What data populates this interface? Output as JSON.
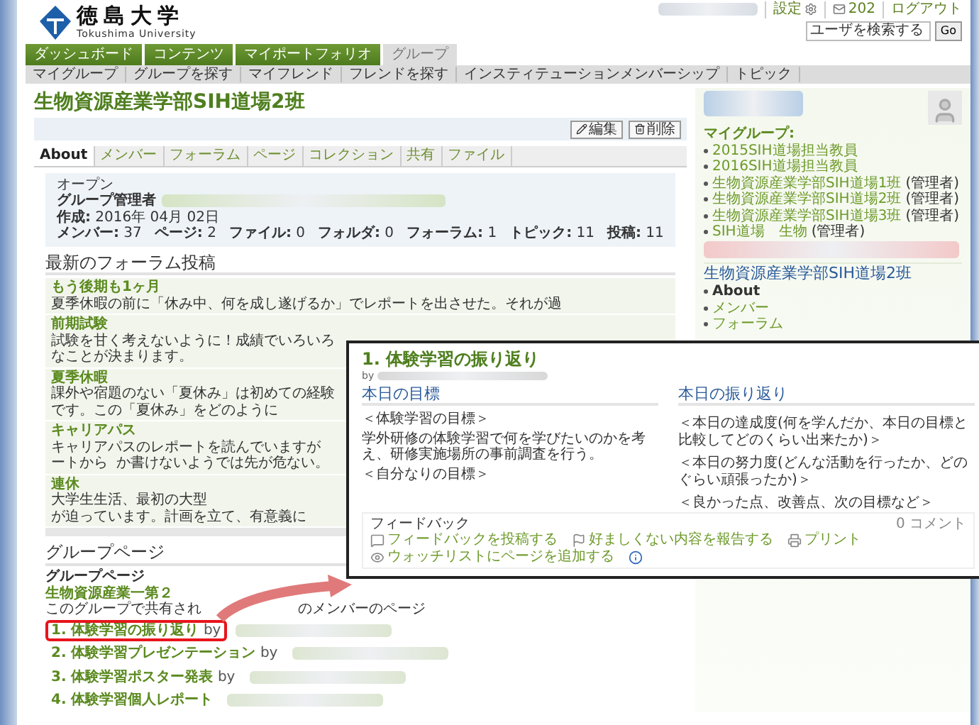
{
  "header": {
    "logo_title": "徳島大学",
    "logo_subtitle": "Tokushima University",
    "top_links": [
      {
        "kind": "settings",
        "label": "設定"
      },
      {
        "kind": "mail",
        "label": "202"
      },
      {
        "kind": "plain",
        "label": "ログアウト"
      }
    ],
    "search": {
      "placeholder": "ユーザを検索する",
      "button": "Go"
    }
  },
  "nav": [
    {
      "label": "ダッシュボード",
      "selected": false
    },
    {
      "label": "コンテンツ",
      "selected": false
    },
    {
      "label": "マイポートフォリオ",
      "selected": false
    },
    {
      "label": "グループ",
      "selected": true
    }
  ],
  "subnav": [
    "マイグループ",
    "グループを探す",
    "マイフレンド",
    "フレンドを探す",
    "インスティテューションメンバーシップ",
    "トピック"
  ],
  "group": {
    "title": "生物資源産業学部SIH道場2班",
    "actions": [
      {
        "kind": "edit",
        "label": "編集"
      },
      {
        "kind": "delete",
        "label": "削除"
      }
    ],
    "tabs": [
      {
        "label": "About",
        "selected": true
      },
      {
        "label": "メンバー",
        "selected": false
      },
      {
        "label": "フォーラム",
        "selected": false
      },
      {
        "label": "ページ",
        "selected": false
      },
      {
        "label": "コレクション",
        "selected": false
      },
      {
        "label": "共有",
        "selected": false
      },
      {
        "label": "ファイル",
        "selected": false
      }
    ],
    "about": {
      "visibility": "オープン",
      "admin_label": "グループ管理者",
      "created": "**作成:** 2016年 04月 02日",
      "stats": [
        "**メンバー:** 37",
        "**ページ:** 2",
        "**ファイル:** 0",
        "**フォルダ:** 0",
        "**フォーラム:** 1",
        "**トピック:** 11",
        "**投稿:** 11"
      ]
    },
    "forum": {
      "heading": "最新のフォーラム投稿",
      "posts": [
        {
          "title": "もう後期も1ヶ月",
          "body": [
            "夏季休暇の前に「休み中、何を成し遂げるか」でレポートを出させた。それが過"
          ]
        },
        {
          "title": "前期試験",
          "body": [
            "試験を甘く考えないように！成績でいろいろなことが決まります。"
          ]
        },
        {
          "title": "夏季休暇",
          "body": [
            "課外や宿題のない「夏休み」は初めての経験です。この「夏休み」をどのように"
          ]
        },
        {
          "title": "キャリアパス",
          "body": [
            "キャリアパスのレポートを読んでいますが",
            "ートから",
            "か書けないようでは先が危ない。"
          ]
        },
        {
          "title": "連休",
          "body": [
            "大学生生活、最初の大型",
            "が迫っています。計画を立て、有意義に"
          ]
        }
      ]
    },
    "pages": {
      "heading": "グループページ",
      "group_pages_label": "グループページ",
      "group_pages": [
        "生物資源産業一第２"
      ],
      "shared_label": [
        "このグループで共有され",
        "のメンバーのページ"
      ],
      "shared": [
        {
          "title": "1. 体験学習の振り返り",
          "by": "by",
          "highlighted": true
        },
        {
          "title": "2. 体験学習プレゼンテーション",
          "by": "by",
          "highlighted": false
        },
        {
          "title": "3. 体験学習ポスター発表",
          "by": "by",
          "highlighted": false
        },
        {
          "title": "4. 体験学習個人レポート",
          "highlighted": false
        }
      ]
    }
  },
  "sidebar": {
    "my_groups_label": "マイグループ:",
    "my_groups": [
      {
        "name": "2015SIH道場担当教員"
      },
      {
        "name": "2016SIH道場担当教員"
      },
      {
        "name": "生物資源産業学部SIH道場1班",
        "role": "(管理者)"
      },
      {
        "name": "生物資源産業学部SIH道場2班",
        "role": "(管理者)"
      },
      {
        "name": "生物資源産業学部SIH道場3班",
        "role": "(管理者)"
      },
      {
        "name": "SIH道場　生物",
        "role": "(管理者)"
      }
    ],
    "group_menu": {
      "title": "生物資源産業学部SIH道場2班",
      "items": [
        "About",
        "メンバー",
        "フォーラム"
      ]
    }
  },
  "popup": {
    "title": "1. 体験学習の振り返り",
    "by": "by",
    "columns": [
      {
        "heading": "本日の目標",
        "lines": [
          "＜体験学習の目標＞",
          "学外研修の体験学習で何を学びたいのかを考え、研修実施場所の事前調査を行う。",
          "＜自分なりの目標＞"
        ]
      },
      {
        "heading": "本日の振り返り",
        "lines": [
          "＜本日の達成度(何を学んだか、本日の目標と比較してどのくらい出来たか)＞",
          "＜本日の努力度(どんな活動を行ったか、どのぐらい頑張ったか)＞",
          "＜良かった点、改善点、次の目標など＞"
        ]
      }
    ],
    "feedback": {
      "heading": "フィードバック",
      "count": "0 コメント",
      "actions": [
        {
          "kind": "comment",
          "label": "フィードバックを投稿する"
        },
        {
          "kind": "flag",
          "label": "好ましくない内容を報告する"
        },
        {
          "kind": "print",
          "label": "プリント"
        },
        {
          "kind": "watch",
          "label": "ウォッチリストにページを追加する"
        },
        {
          "kind": "info"
        }
      ]
    }
  }
}
